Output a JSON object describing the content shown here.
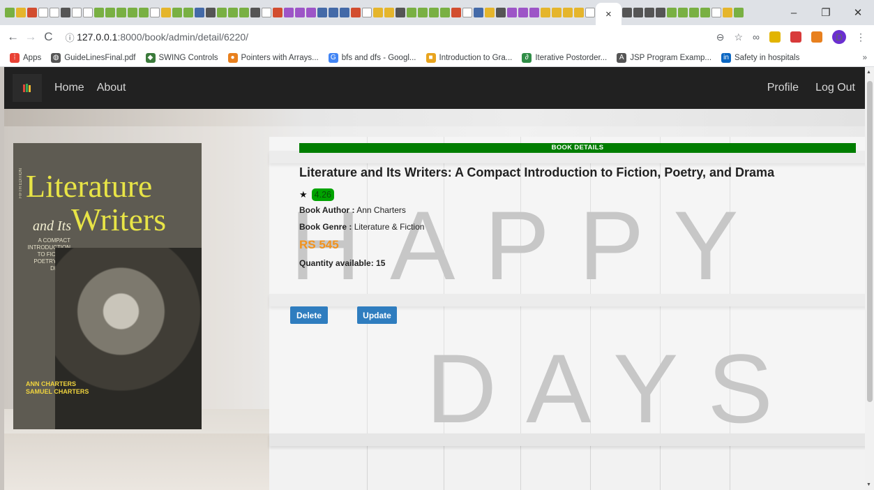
{
  "browser": {
    "active_tab_close": "×",
    "new_tab": "+",
    "window_controls": [
      "–",
      "❐",
      "✕"
    ],
    "nav": {
      "back": "←",
      "forward": "→",
      "reload": "C"
    },
    "url": {
      "host": "127.0.0.1",
      "path": ":8000/book/admin/detail/6220/"
    },
    "bookmarks": [
      {
        "label": "Apps",
        "icon": "apps-grid-icon",
        "color": "#e94235"
      },
      {
        "label": "GuideLinesFinal.pdf",
        "icon": "globe-icon",
        "color": "#555555"
      },
      {
        "label": "SWING Controls",
        "icon": "site-icon",
        "color": "#3b7a3b"
      },
      {
        "label": "Pointers with Arrays...",
        "icon": "tutorials-icon",
        "color": "#e8801e"
      },
      {
        "label": "bfs and dfs - Googl...",
        "icon": "google-icon",
        "color": "#4285f4"
      },
      {
        "label": "Introduction to Gra...",
        "icon": "blog-icon",
        "color": "#e8a41e"
      },
      {
        "label": "Iterative Postorder...",
        "icon": "gfg-icon",
        "color": "#2f8d46"
      },
      {
        "label": "JSP Program Examp...",
        "icon": "bookmark-a-icon",
        "color": "#555555"
      },
      {
        "label": "Safety in hospitals",
        "icon": "linkedin-icon",
        "color": "#0a66c2"
      }
    ],
    "bookmarks_more": "»",
    "profile_initial": "D"
  },
  "navbar": {
    "links": [
      "Home",
      "About"
    ],
    "right_links": [
      "Profile",
      "Log Out"
    ]
  },
  "book": {
    "section_title": "BOOK DETAILS",
    "title": "Literature and Its Writers: A Compact Introduction to Fiction, Poetry, and Drama",
    "rating": "4.26",
    "author_label": "Book Author :",
    "author": "Ann Charters",
    "genre_label": "Book Genre :",
    "genre": "Literature & Fiction",
    "price": "RS 545",
    "quantity": "Quantity available: 15",
    "cover": {
      "title_line1": "Literature",
      "title_and": "and Its",
      "title_line2": "Writers",
      "edition": "FIFTH EDITION",
      "subtitle": "A COMPACT INTRODUCTION TO FICTION, POETRY, AND DRAMA",
      "authors": [
        "ANN CHARTERS",
        "SAMUEL CHARTERS"
      ]
    }
  },
  "actions": {
    "delete": "Delete",
    "update": "Update"
  },
  "background": {
    "word1": "HAPPY",
    "word2": "DAYS"
  },
  "colors": {
    "navbar": "#212121",
    "section_bar": "#007d00",
    "rating_badge": "#00a300",
    "price": "#f2921c",
    "button": "#2f7dbf"
  }
}
